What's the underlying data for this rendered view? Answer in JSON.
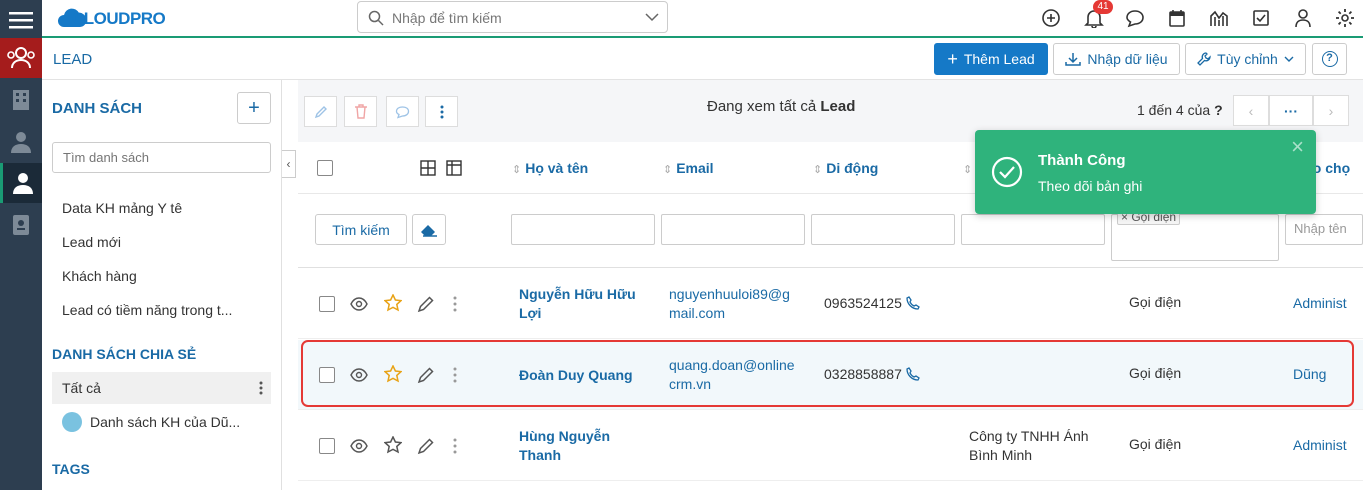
{
  "app": {
    "name": "CLOUDPRO"
  },
  "search": {
    "placeholder": "Nhập để tìm kiếm"
  },
  "notifications": {
    "count": "41"
  },
  "page": {
    "title": "LEAD"
  },
  "toolbar": {
    "add_label": "Thêm Lead",
    "import_label": "Nhập dữ liệu",
    "customize_label": "Tùy chỉnh",
    "help_label": "?"
  },
  "sidebar": {
    "list_heading": "DANH SÁCH",
    "add_label": "+",
    "search_placeholder": "Tìm danh sách",
    "items": [
      "Data KH mảng Y tê",
      "Lead mới",
      "Khách hàng",
      "Lead có tiềm năng trong t..."
    ],
    "shared_heading": "DANH SÁCH CHIA SẺ",
    "shared_items": [
      "Tất cả",
      "Danh sách KH của Dũ..."
    ],
    "tags_heading": "TAGS"
  },
  "list": {
    "view_prefix": "Đang xem tất cả",
    "view_entity": "Lead",
    "pager": "1 đến 4 của",
    "pager_q": "?",
    "search_button": "Tìm kiếm",
    "columns": [
      "Họ và tên",
      "Email",
      "Di động",
      "",
      "ao chọ"
    ],
    "source_filter_tag": "× Gọi điện",
    "owner_filter_placeholder": "Nhập tên",
    "rows": [
      {
        "name": "Nguyễn Hữu Hữu Lợi",
        "email": "nguyenhuuloi89@gmail.com",
        "phone": "0963524125",
        "company": "",
        "source": "Gọi điện",
        "owner": "Administ",
        "starred": true
      },
      {
        "name": "Đoàn Duy Quang",
        "email": "quang.doan@onlinecrm.vn",
        "phone": "0328858887",
        "company": "",
        "source": "Gọi điện",
        "owner": "Dũng",
        "starred": true
      },
      {
        "name": "Hùng Nguyễn Thanh",
        "email": "",
        "phone": "",
        "company": "Công ty TNHH Ánh Bình Minh",
        "source": "Gọi điện",
        "owner": "Administ",
        "starred": false
      }
    ]
  },
  "toast": {
    "title": "Thành Công",
    "message": "Theo dõi bản ghi",
    "close": "×"
  },
  "colors": {
    "rail": "#2d3e50",
    "primary": "#1579c7",
    "link": "#1a6aa5",
    "toast": "#2fb37c",
    "highlight": "#e53935",
    "active_rail": "#a51c1c"
  }
}
